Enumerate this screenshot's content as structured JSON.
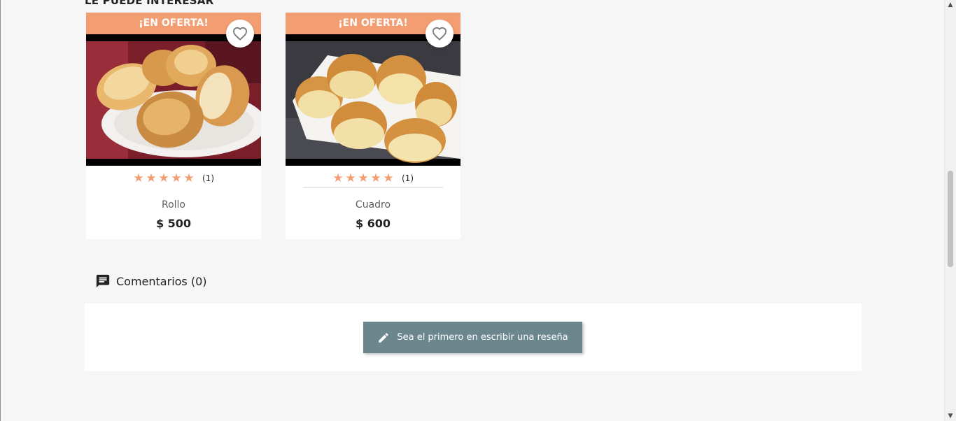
{
  "section": {
    "title": "LE PUEDE INTERESAR"
  },
  "products": [
    {
      "flag": "¡EN OFERTA!",
      "name": "Rollo",
      "price": "$ 500",
      "rating_count": "(1)",
      "stars": 5,
      "wishlist_icon": "heart-outline-icon"
    },
    {
      "flag": "¡EN OFERTA!",
      "name": "Cuadro",
      "price": "$ 600",
      "rating_count": "(1)",
      "stars": 5,
      "wishlist_icon": "heart-outline-icon"
    }
  ],
  "comments": {
    "heading": "Comentarios (0)",
    "heading_icon": "comment-icon",
    "button_label": "Sea el primero en escribir una reseña",
    "button_icon": "pencil-icon"
  },
  "colors": {
    "accent": "#f39d72",
    "button": "#6c868e",
    "page_bg": "#f6f6f6"
  }
}
